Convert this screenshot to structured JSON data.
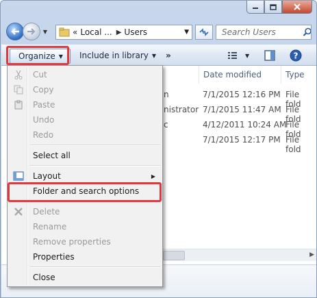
{
  "window": {
    "minimize_icon": "minimize-icon",
    "maximize_icon": "maximize-icon",
    "close_icon": "close-icon"
  },
  "address": {
    "overflow": "«",
    "crumbs": [
      "Local ...",
      "Users"
    ],
    "search_placeholder": "Search Users"
  },
  "toolbar": {
    "organize": "Organize",
    "include": "Include in library",
    "more": "»"
  },
  "columns": {
    "date_modified": "Date modified",
    "type": "Type"
  },
  "rows": [
    {
      "name_fragment": "n",
      "date": "7/1/2015 12:16 PM",
      "type": "File fold"
    },
    {
      "name_fragment": "nistrator",
      "date": "7/1/2015 11:47 AM",
      "type": "File fold"
    },
    {
      "name_fragment": "c",
      "date": "4/12/2011 10:24 AM",
      "type": "File fold"
    },
    {
      "name_fragment": "",
      "date": "7/1/2015 12:17 PM",
      "type": "File fold"
    }
  ],
  "menu": {
    "cut": "Cut",
    "copy": "Copy",
    "paste": "Paste",
    "undo": "Undo",
    "redo": "Redo",
    "select_all": "Select all",
    "layout": "Layout",
    "folder_options": "Folder and search options",
    "delete": "Delete",
    "rename": "Rename",
    "remove_properties": "Remove properties",
    "properties": "Properties",
    "close": "Close"
  },
  "colors": {
    "highlight": "#e0383e"
  }
}
